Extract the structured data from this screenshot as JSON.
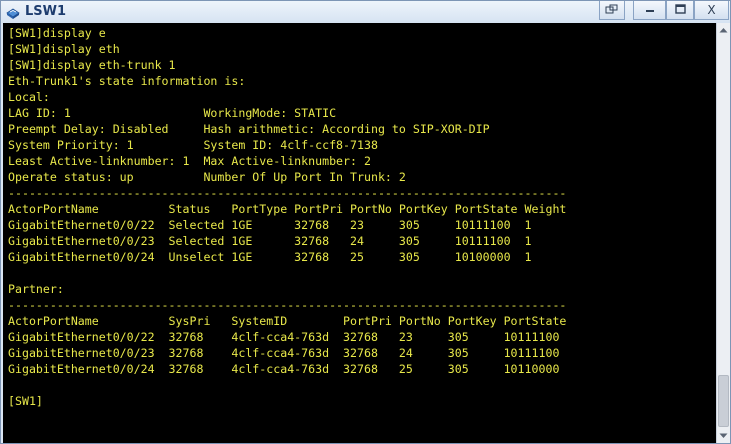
{
  "window": {
    "title": "LSW1",
    "app_icon": "network-device-icon"
  },
  "controls": [
    {
      "name": "restore-small-button",
      "icon": "restore-icon"
    },
    {
      "name": "minimize-button",
      "icon": "minimize-icon"
    },
    {
      "name": "maximize-button",
      "icon": "maximize-icon"
    },
    {
      "name": "close-button",
      "icon": "close-icon",
      "label": "X"
    }
  ],
  "terminal": {
    "text_color": "#e8e84a",
    "background": "#000000",
    "lines": [
      "[SW1]display e",
      "[SW1]display eth",
      "[SW1]display eth-trunk 1",
      "Eth-Trunk1's state information is:",
      "Local:",
      "LAG ID: 1                   WorkingMode: STATIC",
      "Preempt Delay: Disabled     Hash arithmetic: According to SIP-XOR-DIP",
      "System Priority: 1          System ID: 4clf-ccf8-7138",
      "Least Active-linknumber: 1  Max Active-linknumber: 2",
      "Operate status: up          Number Of Up Port In Trunk: 2",
      "--------------------------------------------------------------------------------",
      "ActorPortName          Status   PortType PortPri PortNo PortKey PortState Weight",
      "GigabitEthernet0/0/22  Selected 1GE      32768   23     305     10111100  1",
      "GigabitEthernet0/0/23  Selected 1GE      32768   24     305     10111100  1",
      "GigabitEthernet0/0/24  Unselect 1GE      32768   25     305     10100000  1",
      "",
      "Partner:",
      "--------------------------------------------------------------------------------",
      "ActorPortName          SysPri   SystemID        PortPri PortNo PortKey PortState",
      "GigabitEthernet0/0/22  32768    4clf-cca4-763d  32768   23     305     10111100",
      "GigabitEthernet0/0/23  32768    4clf-cca4-763d  32768   24     305     10111100",
      "GigabitEthernet0/0/24  32768    4clf-cca4-763d  32768   25     305     10110000",
      "",
      "[SW1]"
    ]
  },
  "scrollbar": {
    "position": 0.95
  }
}
